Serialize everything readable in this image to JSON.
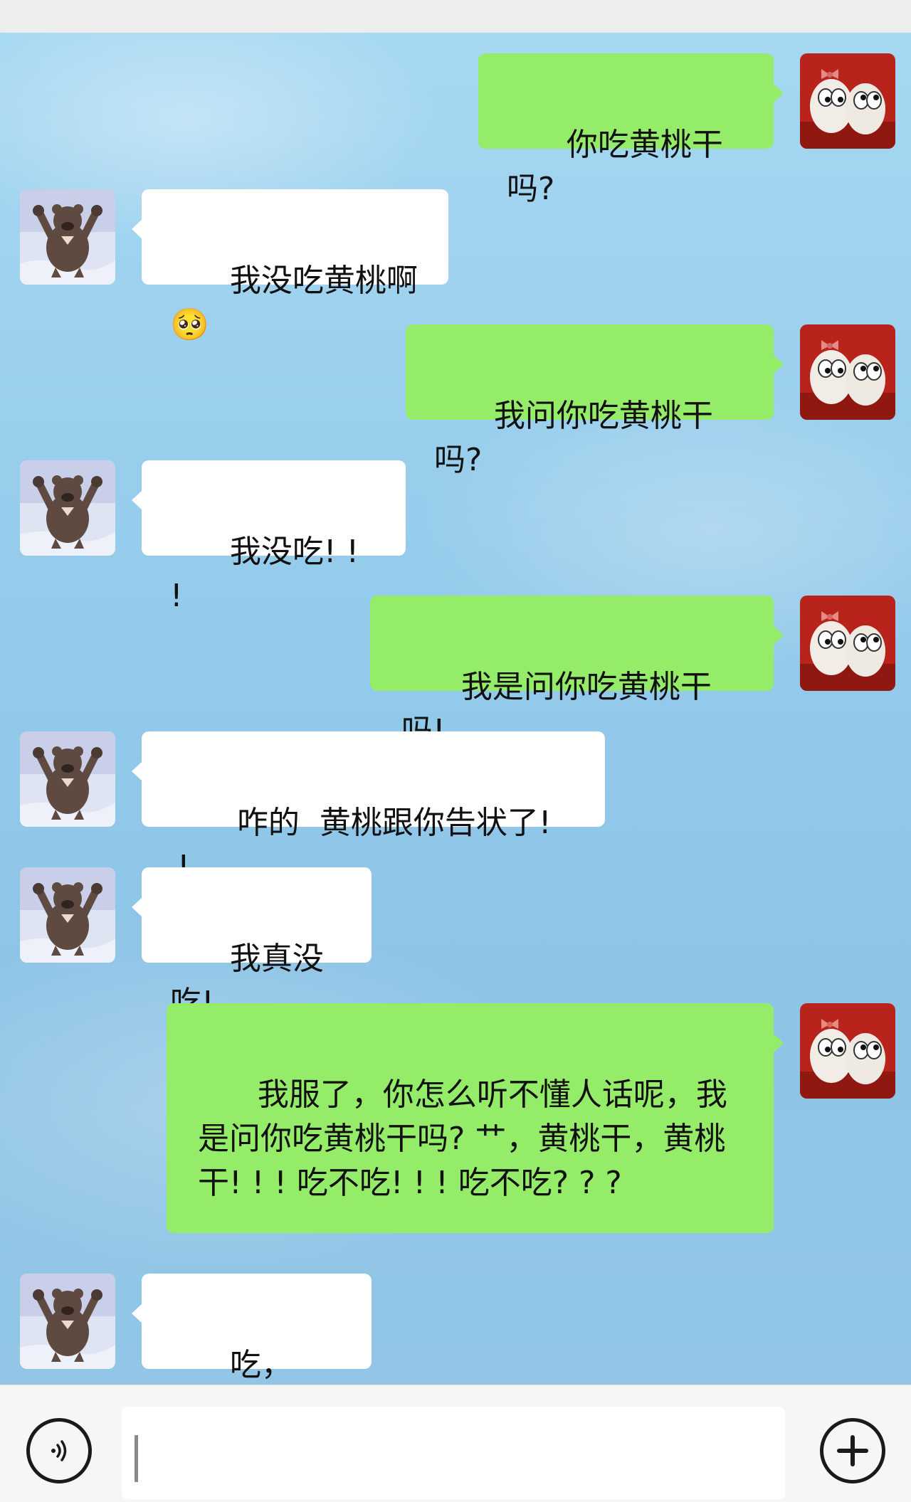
{
  "messages": [
    {
      "sender": "me",
      "text": "你吃黄桃干吗?"
    },
    {
      "sender": "them",
      "text": "我没吃黄桃啊🥺"
    },
    {
      "sender": "me",
      "text": "我问你吃黄桃干吗?"
    },
    {
      "sender": "them",
      "text": "我没吃! ! !"
    },
    {
      "sender": "me",
      "text": "我是问你吃黄桃干吗!"
    },
    {
      "sender": "them",
      "text": "咋的  黄桃跟你告状了! !"
    },
    {
      "sender": "them",
      "text": "我真没吃!"
    },
    {
      "sender": "me",
      "text": "我服了，你怎么听不懂人话呢，我是问你吃黄桃干吗? 艹，黄桃干，黄桃干! ! ! 吃不吃! ! ! 吃不吃? ? ?"
    },
    {
      "sender": "them",
      "text": "吃，吃，吃"
    }
  ],
  "input": {
    "value": ""
  },
  "icons": {
    "voice": "voice-icon",
    "plus": "plus-icon",
    "my_avatar": "eggs-avatar",
    "their_avatar": "bear-avatar"
  },
  "colors": {
    "my_bubble": "#95ec69",
    "their_bubble": "#ffffff",
    "chat_background": "#93c6e6"
  }
}
